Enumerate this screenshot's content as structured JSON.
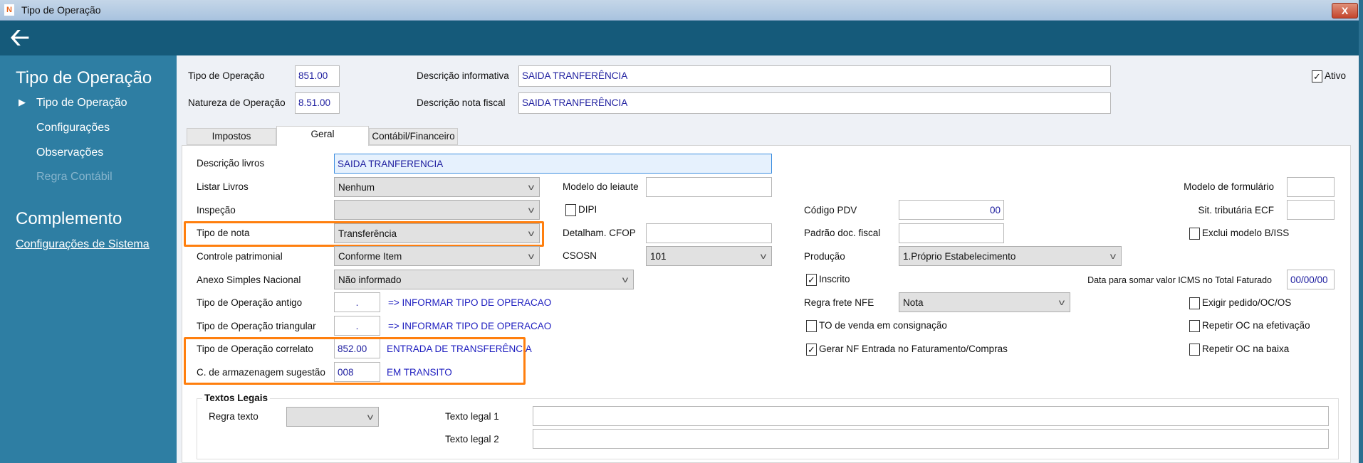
{
  "window": {
    "title": "Tipo de Operação",
    "close_label": "X"
  },
  "sidebar": {
    "title": "Tipo de Operação",
    "items": [
      {
        "label": "Tipo de Operação"
      },
      {
        "label": "Configurações"
      },
      {
        "label": "Observações"
      },
      {
        "label": "Regra Contábil"
      }
    ],
    "section2": "Complemento",
    "link": "Configurações de Sistema"
  },
  "header": {
    "tipo_label": "Tipo de Operação",
    "tipo_value": "851.00",
    "natureza_label": "Natureza de Operação",
    "natureza_value": "8.51.00",
    "desc_info_label": "Descrição informativa",
    "desc_info_value": "SAIDA TRANFERÊNCIA",
    "desc_nf_label": "Descrição nota fiscal",
    "desc_nf_value": "SAIDA TRANFERÊNCIA",
    "ativo_label": "Ativo",
    "ativo_checked": true
  },
  "tabs": [
    {
      "label": "Impostos"
    },
    {
      "label": "Geral"
    },
    {
      "label": "Contábil/Financeiro"
    }
  ],
  "form": {
    "descricao_livros": {
      "label": "Descrição livros",
      "value": "SAIDA TRANFERENCIA"
    },
    "listar_livros": {
      "label": "Listar Livros",
      "value": "Nenhum"
    },
    "inspecao": {
      "label": "Inspeção",
      "value": ""
    },
    "tipo_nota": {
      "label": "Tipo de nota",
      "value": "Transferência"
    },
    "controle_patrimonial": {
      "label": "Controle patrimonial",
      "value": "Conforme Item"
    },
    "anexo": {
      "label": "Anexo Simples Nacional",
      "value": "Não informado"
    },
    "tipo_antigo": {
      "label": "Tipo de Operação antigo",
      "value": ".",
      "link": "=> INFORMAR TIPO DE OPERACAO"
    },
    "tipo_triangular": {
      "label": "Tipo de Operação triangular",
      "value": ".",
      "link": "=> INFORMAR TIPO DE OPERACAO"
    },
    "tipo_correlato": {
      "label": "Tipo de Operação correlato",
      "value": "852.00",
      "desc": "ENTRADA DE TRANSFERÊNCIA"
    },
    "armazenagem": {
      "label": "C. de armazenagem sugestão",
      "value": "008",
      "desc": "EM TRANSITO"
    },
    "modelo_leiaute": {
      "label": "Modelo do leiaute",
      "value": ""
    },
    "dipi": {
      "label": "DIPI",
      "checked": false
    },
    "detalham_cfop": {
      "label": "Detalham. CFOP",
      "value": ""
    },
    "csosn": {
      "label": "CSOSN",
      "value": "101"
    },
    "codigo_pdv": {
      "label": "Código PDV",
      "value": "00"
    },
    "padrao_doc": {
      "label": "Padrão doc. fiscal",
      "value": ""
    },
    "producao": {
      "label": "Produção",
      "value": "1.Próprio Estabelecimento"
    },
    "inscrito": {
      "label": "Inscrito",
      "checked": true
    },
    "regra_frete": {
      "label": "Regra frete NFE",
      "value": "Nota"
    },
    "to_consignacao": {
      "label": "TO de venda em consignação",
      "checked": false
    },
    "gerar_nf": {
      "label": "Gerar NF Entrada no Faturamento/Compras",
      "checked": true
    },
    "modelo_formulario": {
      "label": "Modelo de formulário",
      "value": ""
    },
    "sit_tributaria": {
      "label": "Sit. tributária ECF",
      "value": ""
    },
    "exclui_modelo": {
      "label": "Exclui modelo B/ISS",
      "checked": false
    },
    "data_icms": {
      "label": "Data para somar valor ICMS no Total Faturado",
      "value": "00/00/00"
    },
    "exigir_pedido": {
      "label": "Exigir pedido/OC/OS",
      "checked": false
    },
    "repetir_efetivacao": {
      "label": "Repetir OC na efetivação",
      "checked": false
    },
    "repetir_baixa": {
      "label": "Repetir OC na baixa",
      "checked": false
    }
  },
  "textos_legais": {
    "title": "Textos Legais",
    "regra_label": "Regra texto",
    "regra_value": "",
    "texto1_label": "Texto legal 1",
    "texto1_value": "",
    "texto2_label": "Texto legal 2",
    "texto2_value": ""
  },
  "colors": {
    "header": "#155a7a",
    "sidebar": "#2e7ea3",
    "highlight": "#ff7f0e",
    "value_text": "#2020a0"
  }
}
